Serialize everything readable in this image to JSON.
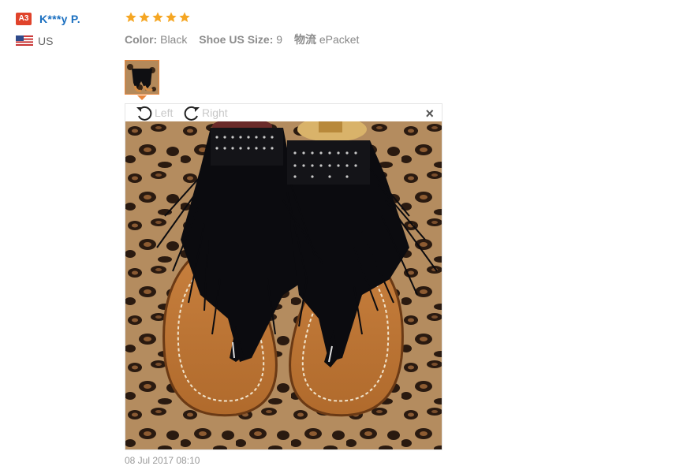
{
  "user": {
    "level_badge": "A3",
    "name": "K***y P.",
    "country_flag": "us-flag-icon",
    "country": "US"
  },
  "review": {
    "rating": 5,
    "rating_max": 5,
    "attributes": [
      {
        "key": "Color:",
        "value": "Black"
      },
      {
        "key": "Shoe US Size:",
        "value": "9"
      },
      {
        "key": "物流",
        "value": "ePacket"
      }
    ],
    "date": "08 Jul 2017 08:10"
  },
  "viewer": {
    "rotate_left_label": "Left",
    "rotate_right_label": "Right",
    "close_label": "×",
    "image_subject": "black fringe flat sandals on leopard-print fabric"
  },
  "colors": {
    "star": "#f5a623",
    "badge": "#e0432b",
    "username": "#1a6fc0",
    "thumb_border": "#e9853b"
  }
}
